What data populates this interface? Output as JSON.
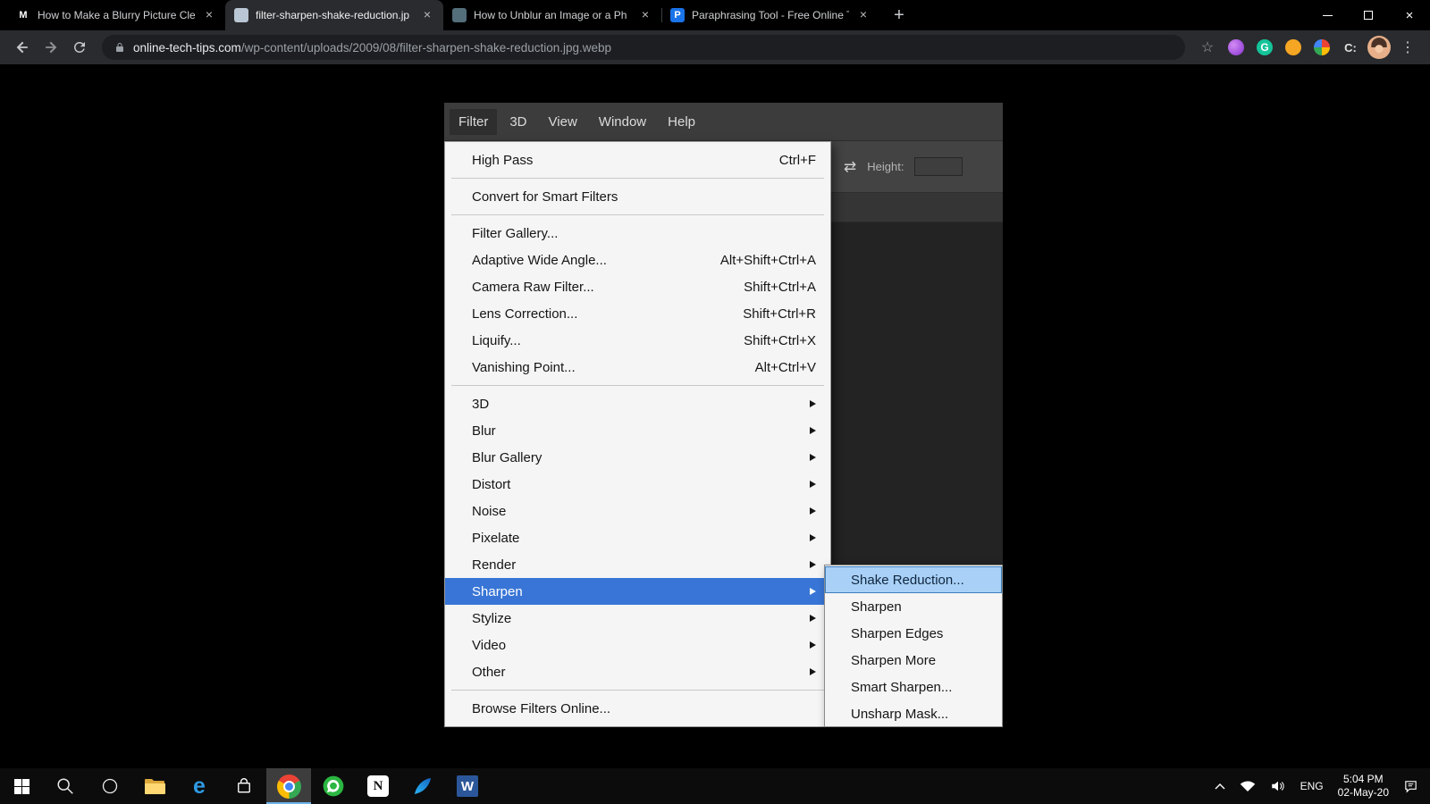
{
  "colors": {
    "menu-highlight": "#3875d6",
    "submenu-highlight": "#a9d1f7",
    "submenu-highlight-border": "#3c7fc1",
    "taskbar-active": "#3d3d3d"
  },
  "icons": {
    "close": "×",
    "new_tab": "+",
    "kebab": "⋮",
    "star": "☆",
    "swap": "⇄",
    "ext_g": "G",
    "ext_c": "C:",
    "edge_e": "e",
    "notion_n": "N",
    "word_w": "W"
  },
  "browser": {
    "tabs": [
      {
        "title": "How to Make a Blurry Picture Cle",
        "active": false,
        "icon": {
          "text": "M",
          "bg": "transparent",
          "fg": "#ffffff"
        }
      },
      {
        "title": "filter-sharpen-shake-reduction.jp",
        "active": true,
        "icon": {
          "text": "",
          "bg": "#b9c6d3",
          "fg": "#ffffff"
        }
      },
      {
        "title": "How to Unblur an Image or a Ph",
        "active": false,
        "icon": {
          "text": "",
          "bg": "#546e7a",
          "fg": "#ffffff"
        }
      },
      {
        "title": "Paraphrasing Tool - Free Online T",
        "active": false,
        "icon": {
          "text": "P",
          "bg": "#1a73e8",
          "fg": "#ffffff"
        }
      }
    ],
    "url_domain": "online-tech-tips.com",
    "url_path": "/wp-content/uploads/2009/08/filter-sharpen-shake-reduction.jpg.webp"
  },
  "photoshop": {
    "menubar": [
      {
        "label": "Filter",
        "active": true
      },
      {
        "label": "3D"
      },
      {
        "label": "View"
      },
      {
        "label": "Window"
      },
      {
        "label": "Help"
      }
    ],
    "options_bar": {
      "height_label": "Height:"
    },
    "filter_menu": {
      "section1": [
        {
          "label": "High Pass",
          "shortcut": "Ctrl+F"
        }
      ],
      "section2": [
        {
          "label": "Convert for Smart Filters",
          "shortcut": ""
        }
      ],
      "section3": [
        {
          "label": "Filter Gallery...",
          "shortcut": ""
        },
        {
          "label": "Adaptive Wide Angle...",
          "shortcut": "Alt+Shift+Ctrl+A"
        },
        {
          "label": "Camera Raw Filter...",
          "shortcut": "Shift+Ctrl+A"
        },
        {
          "label": "Lens Correction...",
          "shortcut": "Shift+Ctrl+R"
        },
        {
          "label": "Liquify...",
          "shortcut": "Shift+Ctrl+X"
        },
        {
          "label": "Vanishing Point...",
          "shortcut": "Alt+Ctrl+V"
        }
      ],
      "section4": [
        {
          "label": "3D"
        },
        {
          "label": "Blur"
        },
        {
          "label": "Blur Gallery"
        },
        {
          "label": "Distort"
        },
        {
          "label": "Noise"
        },
        {
          "label": "Pixelate"
        },
        {
          "label": "Render"
        },
        {
          "label": "Sharpen",
          "highlighted": true
        },
        {
          "label": "Stylize"
        },
        {
          "label": "Video"
        },
        {
          "label": "Other"
        }
      ],
      "section5": [
        {
          "label": "Browse Filters Online...",
          "shortcut": ""
        }
      ]
    },
    "sharpen_submenu": [
      {
        "label": "Shake Reduction...",
        "highlighted": true
      },
      {
        "label": "Sharpen"
      },
      {
        "label": "Sharpen Edges"
      },
      {
        "label": "Sharpen More"
      },
      {
        "label": "Smart Sharpen..."
      },
      {
        "label": "Unsharp Mask..."
      }
    ]
  },
  "taskbar": {
    "language": "ENG",
    "time": "5:04 PM",
    "date": "02-May-20"
  }
}
